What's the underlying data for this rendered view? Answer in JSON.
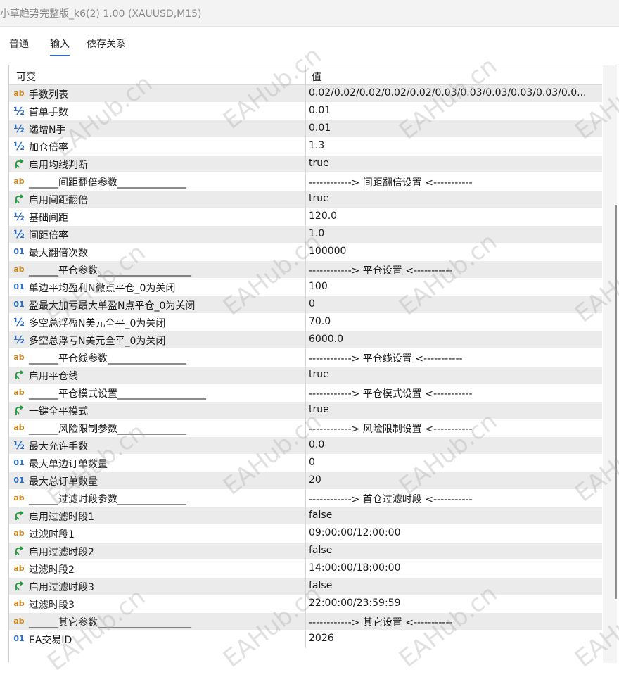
{
  "window": {
    "title": "小草趋势完整版_k6(2) 1.00 (XAUUSD,M15)"
  },
  "tabs": [
    {
      "label": "普通",
      "active": false
    },
    {
      "label": "输入",
      "active": true
    },
    {
      "label": "依存关系",
      "active": false
    }
  ],
  "grid": {
    "col_variable": "可变",
    "col_value": "值",
    "rows": [
      {
        "icon": "ab",
        "name": "手数列表",
        "value": "0.02/0.02/0.02/0.02/0.02/0.03/0.03/0.03/0.03/0.03/0.0..."
      },
      {
        "icon": "half",
        "name": "首单手数",
        "value": "0.01"
      },
      {
        "icon": "half",
        "name": "递增N手",
        "value": "0.01"
      },
      {
        "icon": "half",
        "name": "加仓倍率",
        "value": "1.3"
      },
      {
        "icon": "bool",
        "name": "启用均线判断",
        "value": "true"
      },
      {
        "icon": "ab",
        "name": "______间距翻倍参数______________",
        "value": "------------> 间距翻倍设置 <-----------"
      },
      {
        "icon": "bool",
        "name": "启用间距翻倍",
        "value": "true"
      },
      {
        "icon": "half",
        "name": "基础间距",
        "value": "120.0"
      },
      {
        "icon": "half",
        "name": "间距倍率",
        "value": "1.0"
      },
      {
        "icon": "01",
        "name": "最大翻倍次数",
        "value": "100000"
      },
      {
        "icon": "ab",
        "name": "______平仓参数___________________",
        "value": "------------> 平仓设置 <-----------"
      },
      {
        "icon": "01",
        "name": "单边平均盈利N微点平仓_0为关闭",
        "value": "100"
      },
      {
        "icon": "01",
        "name": "盈最大加亏最大单盈N点平仓_0为关闭",
        "value": "0"
      },
      {
        "icon": "half",
        "name": "多空总浮盈N美元全平_0为关闭",
        "value": "70.0"
      },
      {
        "icon": "half",
        "name": "多空总浮亏N美元全平_0为关闭",
        "value": "6000.0"
      },
      {
        "icon": "ab",
        "name": "______平仓线参数________________",
        "value": "------------> 平仓线设置 <-----------"
      },
      {
        "icon": "bool",
        "name": "启用平仓线",
        "value": "true"
      },
      {
        "icon": "ab",
        "name": "______平仓模式设置__________________",
        "value": "------------> 平仓模式设置 <-----------"
      },
      {
        "icon": "bool",
        "name": "一键全平模式",
        "value": "true"
      },
      {
        "icon": "ab",
        "name": "______风险限制参数______________",
        "value": "------------> 风险限制设置 <-----------"
      },
      {
        "icon": "half",
        "name": "最大允许手数",
        "value": "0.0"
      },
      {
        "icon": "01",
        "name": "最大单边订单数量",
        "value": "0"
      },
      {
        "icon": "01",
        "name": "最大总订单数量",
        "value": "20"
      },
      {
        "icon": "ab",
        "name": "______过滤时段参数______________",
        "value": "------------> 首仓过滤时段 <-----------"
      },
      {
        "icon": "bool",
        "name": "启用过滤时段1",
        "value": "false"
      },
      {
        "icon": "ab",
        "name": "过滤时段1",
        "value": "09:00:00/12:00:00"
      },
      {
        "icon": "bool",
        "name": "启用过滤时段2",
        "value": "false"
      },
      {
        "icon": "ab",
        "name": "过滤时段2",
        "value": "14:00:00/18:00:00"
      },
      {
        "icon": "bool",
        "name": "启用过滤时段3",
        "value": "false"
      },
      {
        "icon": "ab",
        "name": "过滤时段3",
        "value": "22:00:00/23:59:59"
      },
      {
        "icon": "ab",
        "name": "______其它参数___________________",
        "value": "------------> 其它设置 <-----------"
      },
      {
        "icon": "01",
        "name": "EA交易ID",
        "value": "2026"
      }
    ]
  },
  "watermark": "EAHub.cn",
  "colors": {
    "accent": "#2b6cc4",
    "string_icon": "#c8841c",
    "bool_icon": "#1f9a3a",
    "row_alt": "#ebebeb"
  }
}
